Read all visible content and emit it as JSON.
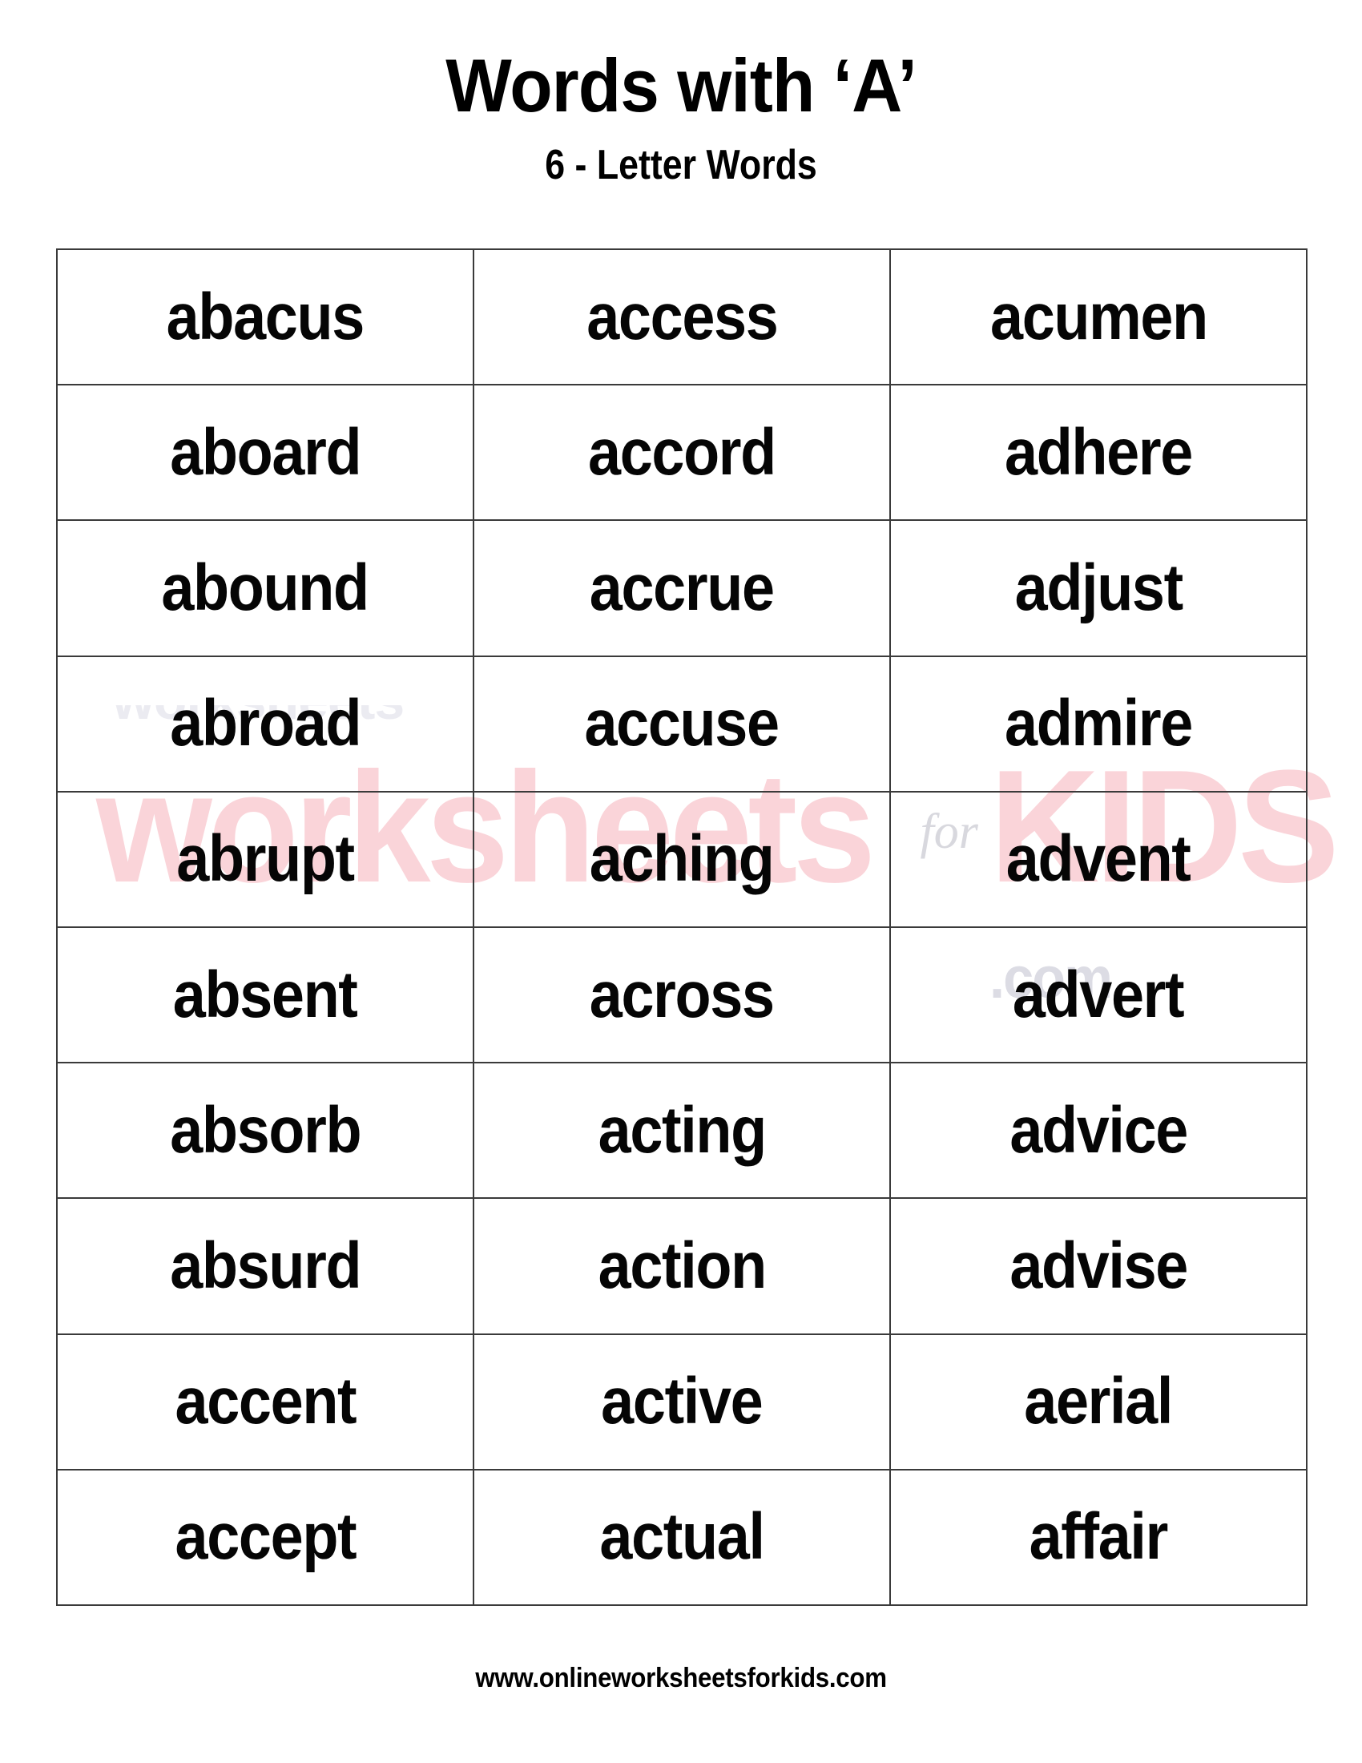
{
  "header": {
    "title": "Words with ‘A’",
    "subtitle": "6 - Letter Words"
  },
  "watermark": {
    "brand_part1": "worksheets",
    "brand_connector": "for",
    "brand_part2": "KIDS",
    "brand_tld": ".com",
    "ghost_text": "worksheets",
    "pink_color": "#fad4d9",
    "gray_color": "#dcdce4"
  },
  "table": {
    "columns": 3,
    "rows": 10,
    "border_color": "#3a3a3a",
    "cells": [
      [
        "abacus",
        "access",
        "acumen"
      ],
      [
        "aboard",
        "accord",
        "adhere"
      ],
      [
        "abound",
        "accrue",
        "adjust"
      ],
      [
        "abroad",
        "accuse",
        "admire"
      ],
      [
        "abrupt",
        "aching",
        "advent"
      ],
      [
        "absent",
        "across",
        "advert"
      ],
      [
        "absorb",
        "acting",
        "advice"
      ],
      [
        "absurd",
        "action",
        "advise"
      ],
      [
        "accent",
        "active",
        "aerial"
      ],
      [
        "accept",
        "actual",
        "affair"
      ]
    ]
  },
  "footer": {
    "url": "www.onlineworksheetsforkids.com"
  }
}
